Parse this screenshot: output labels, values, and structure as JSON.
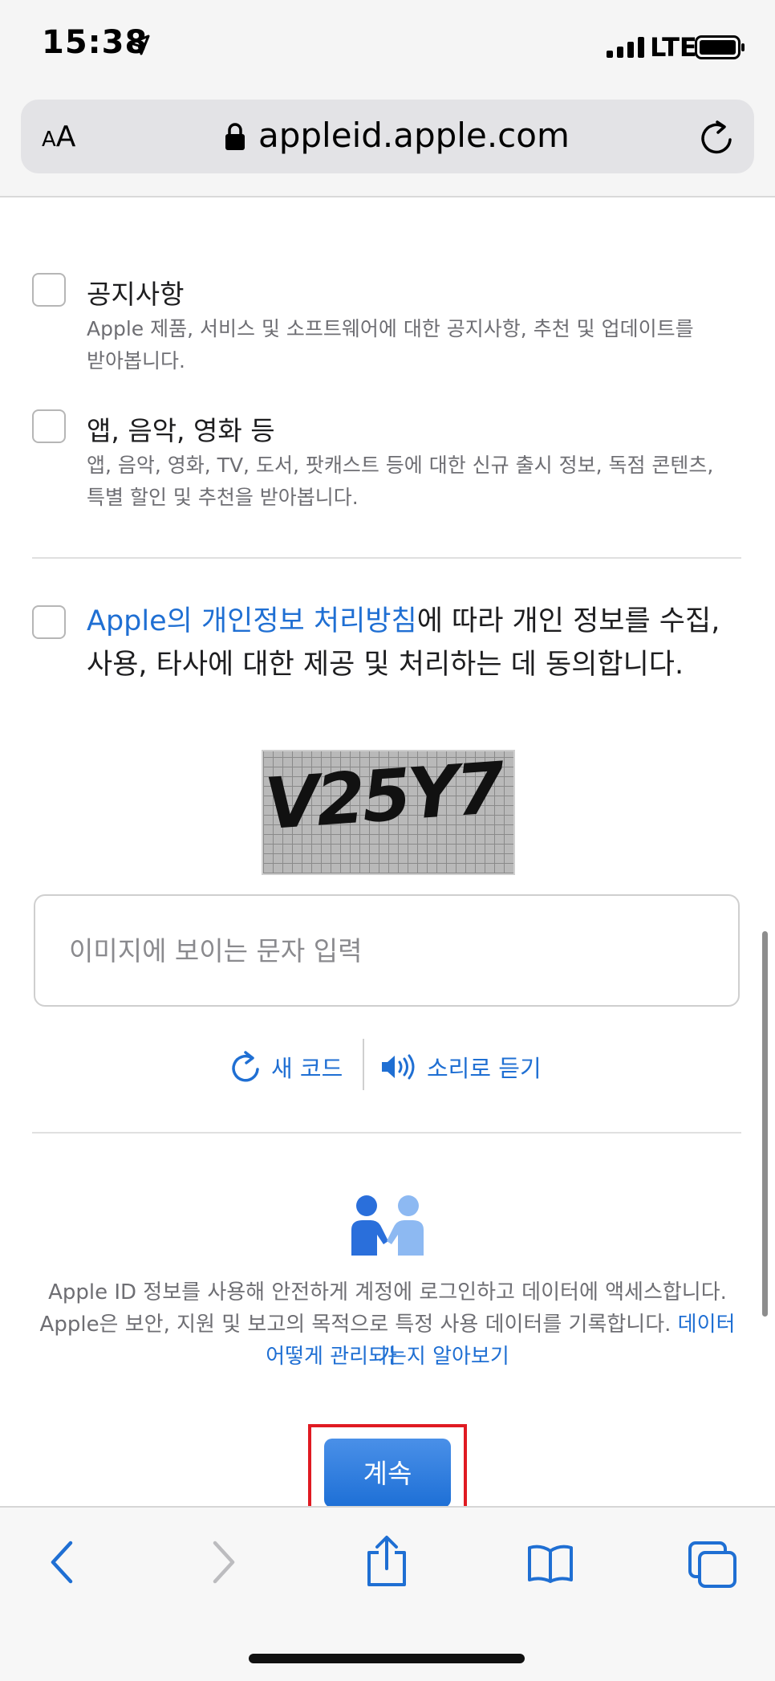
{
  "status_bar": {
    "time": "15:38",
    "network": "LTE"
  },
  "browser": {
    "text_size_small": "A",
    "text_size_large": "A",
    "url": "appleid.apple.com"
  },
  "options": [
    {
      "title": "공지사항",
      "desc_line1": "Apple 제품, 서비스 및 소프트웨어에 대한 공지사항, 추천 및 업데이트를",
      "desc_line2": "받아봅니다."
    },
    {
      "title": "앱, 음악, 영화 등",
      "desc_line1": "앱, 음악, 영화, TV, 도서, 팟캐스트 등에 대한 신규 출시 정보, 독점 콘텐츠,",
      "desc_line2": "특별 할인 및 추천을 받아봅니다."
    }
  ],
  "consent": {
    "link_text": "Apple의 개인정보 처리방침",
    "text_line1_rest": "에 따라 개인 정보를 수집,",
    "text_line2": "사용, 타사에 대한 제공 및 처리하는 데 동의합니다."
  },
  "captcha": {
    "image_text": "V25Y7",
    "placeholder": "이미지에 보이는 문자 입력",
    "new_code": "새 코드",
    "audio": "소리로 듣기"
  },
  "info": {
    "line1": "Apple ID 정보를 사용해 안전하게 계정에 로그인하고 데이터에 액세스합니다.",
    "line2": "Apple은 보안, 지원 및 보고의 목적으로 특정 사용 데이터를 기록합니다.",
    "link_part1": "데이터가",
    "link_part2": "어떻게 관리되는지 알아보기"
  },
  "continue_label": "계속",
  "colors": {
    "accent": "#1f6fd3",
    "highlight": "#e01a22"
  }
}
